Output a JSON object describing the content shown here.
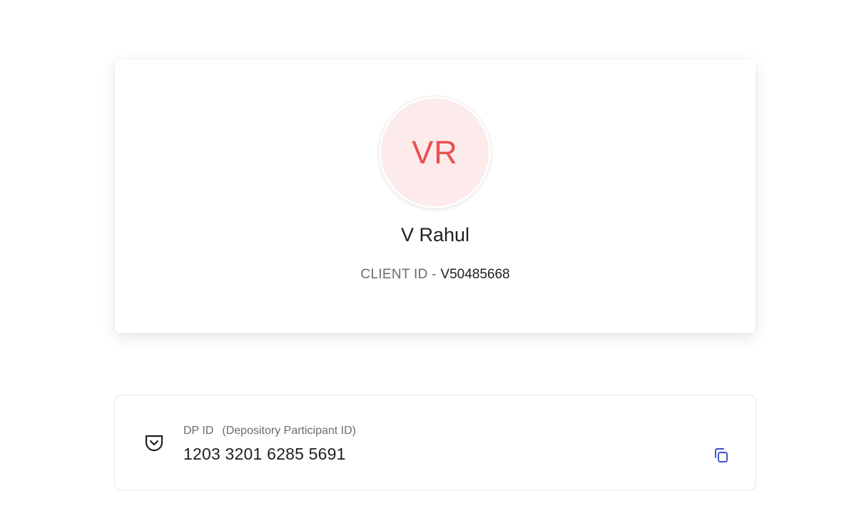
{
  "profile": {
    "initials": "VR",
    "name": "V Rahul",
    "client_id_label": "CLIENT ID - ",
    "client_id_value": "V50485668",
    "colors": {
      "avatar_bg": "#fdeaea",
      "avatar_text": "#e8504f"
    }
  },
  "dp": {
    "icon": "pocket-icon",
    "label": "DP ID",
    "sub_label": "(Depository Participant ID)",
    "value": "1203 3201 6285 5691",
    "copy_icon": "copy-icon",
    "accent_color": "#3a50c8"
  }
}
